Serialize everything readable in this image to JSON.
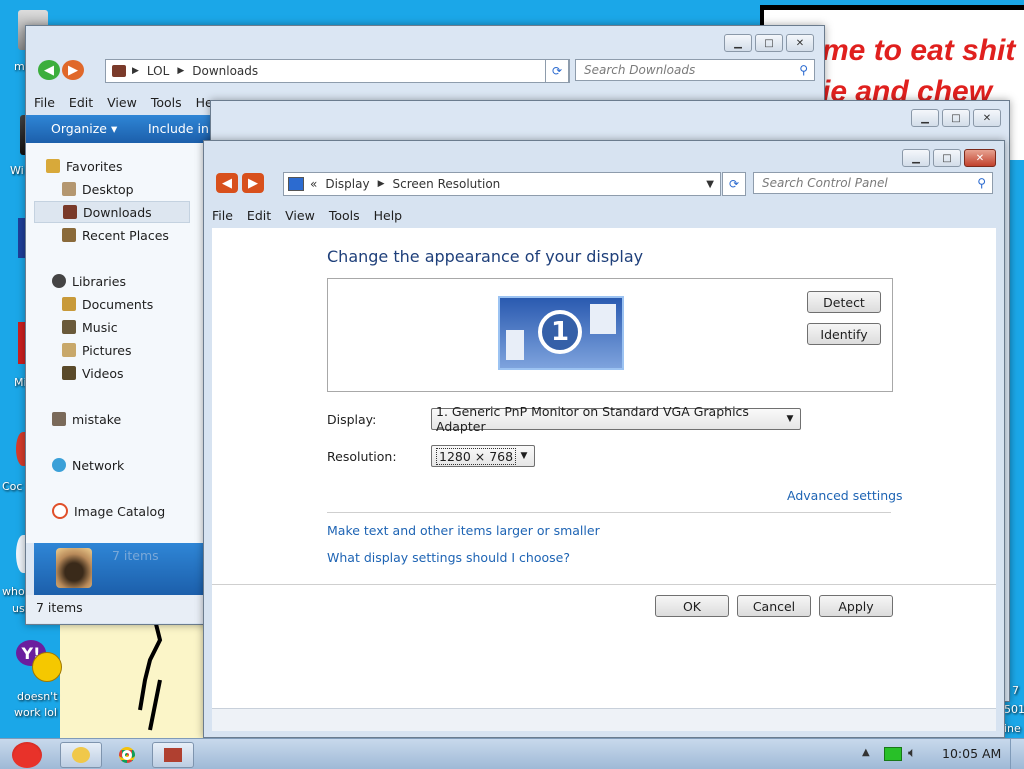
{
  "desktop": {
    "icon_labels": [
      "m",
      "Wi",
      "Mi",
      "Coc",
      "who",
      "us",
      "doesn't",
      "work lol"
    ],
    "paint_text_line1": "me to eat shit",
    "paint_text_line2": "ie and chew",
    "right_edge_text": [
      "7",
      "501",
      "ine"
    ]
  },
  "explorer_back": {
    "breadcrumb": [
      "LOL",
      "Downloads"
    ],
    "search_placeholder": "Search Downloads",
    "menu": [
      "File",
      "Edit",
      "View",
      "Tools",
      "He"
    ],
    "toolbar": {
      "organize": "Organize",
      "include": "Include in l"
    },
    "nav": {
      "favorites": "Favorites",
      "desktop": "Desktop",
      "downloads": "Downloads",
      "recent": "Recent Places",
      "libraries": "Libraries",
      "documents": "Documents",
      "music": "Music",
      "pictures": "Pictures",
      "videos": "Videos",
      "mistake": "mistake",
      "network": "Network",
      "image_catalog": "Image Catalog"
    },
    "details_count": "7 items",
    "status": "7 items"
  },
  "control_panel": {
    "breadcrumb_prefix": "«",
    "breadcrumb": [
      "Display",
      "Screen Resolution"
    ],
    "search_placeholder": "Search Control Panel",
    "menu": [
      "File",
      "Edit",
      "View",
      "Tools",
      "Help"
    ],
    "heading": "Change the appearance of your display",
    "monitor_number": "1",
    "detect": "Detect",
    "identify": "Identify",
    "display_label": "Display:",
    "display_value": "1. Generic PnP Monitor on Standard VGA Graphics Adapter",
    "resolution_label": "Resolution:",
    "resolution_value": "1280 × 768",
    "advanced": "Advanced settings",
    "link_text_size": "Make text and other items larger or smaller",
    "link_which": "What display settings should I choose?",
    "ok": "OK",
    "cancel": "Cancel",
    "apply": "Apply"
  },
  "taskbar": {
    "clock": "10:05 AM"
  },
  "colors": {
    "accent": "#1ba7e8",
    "heading": "#1e3f7a",
    "link": "#1e64b4"
  }
}
